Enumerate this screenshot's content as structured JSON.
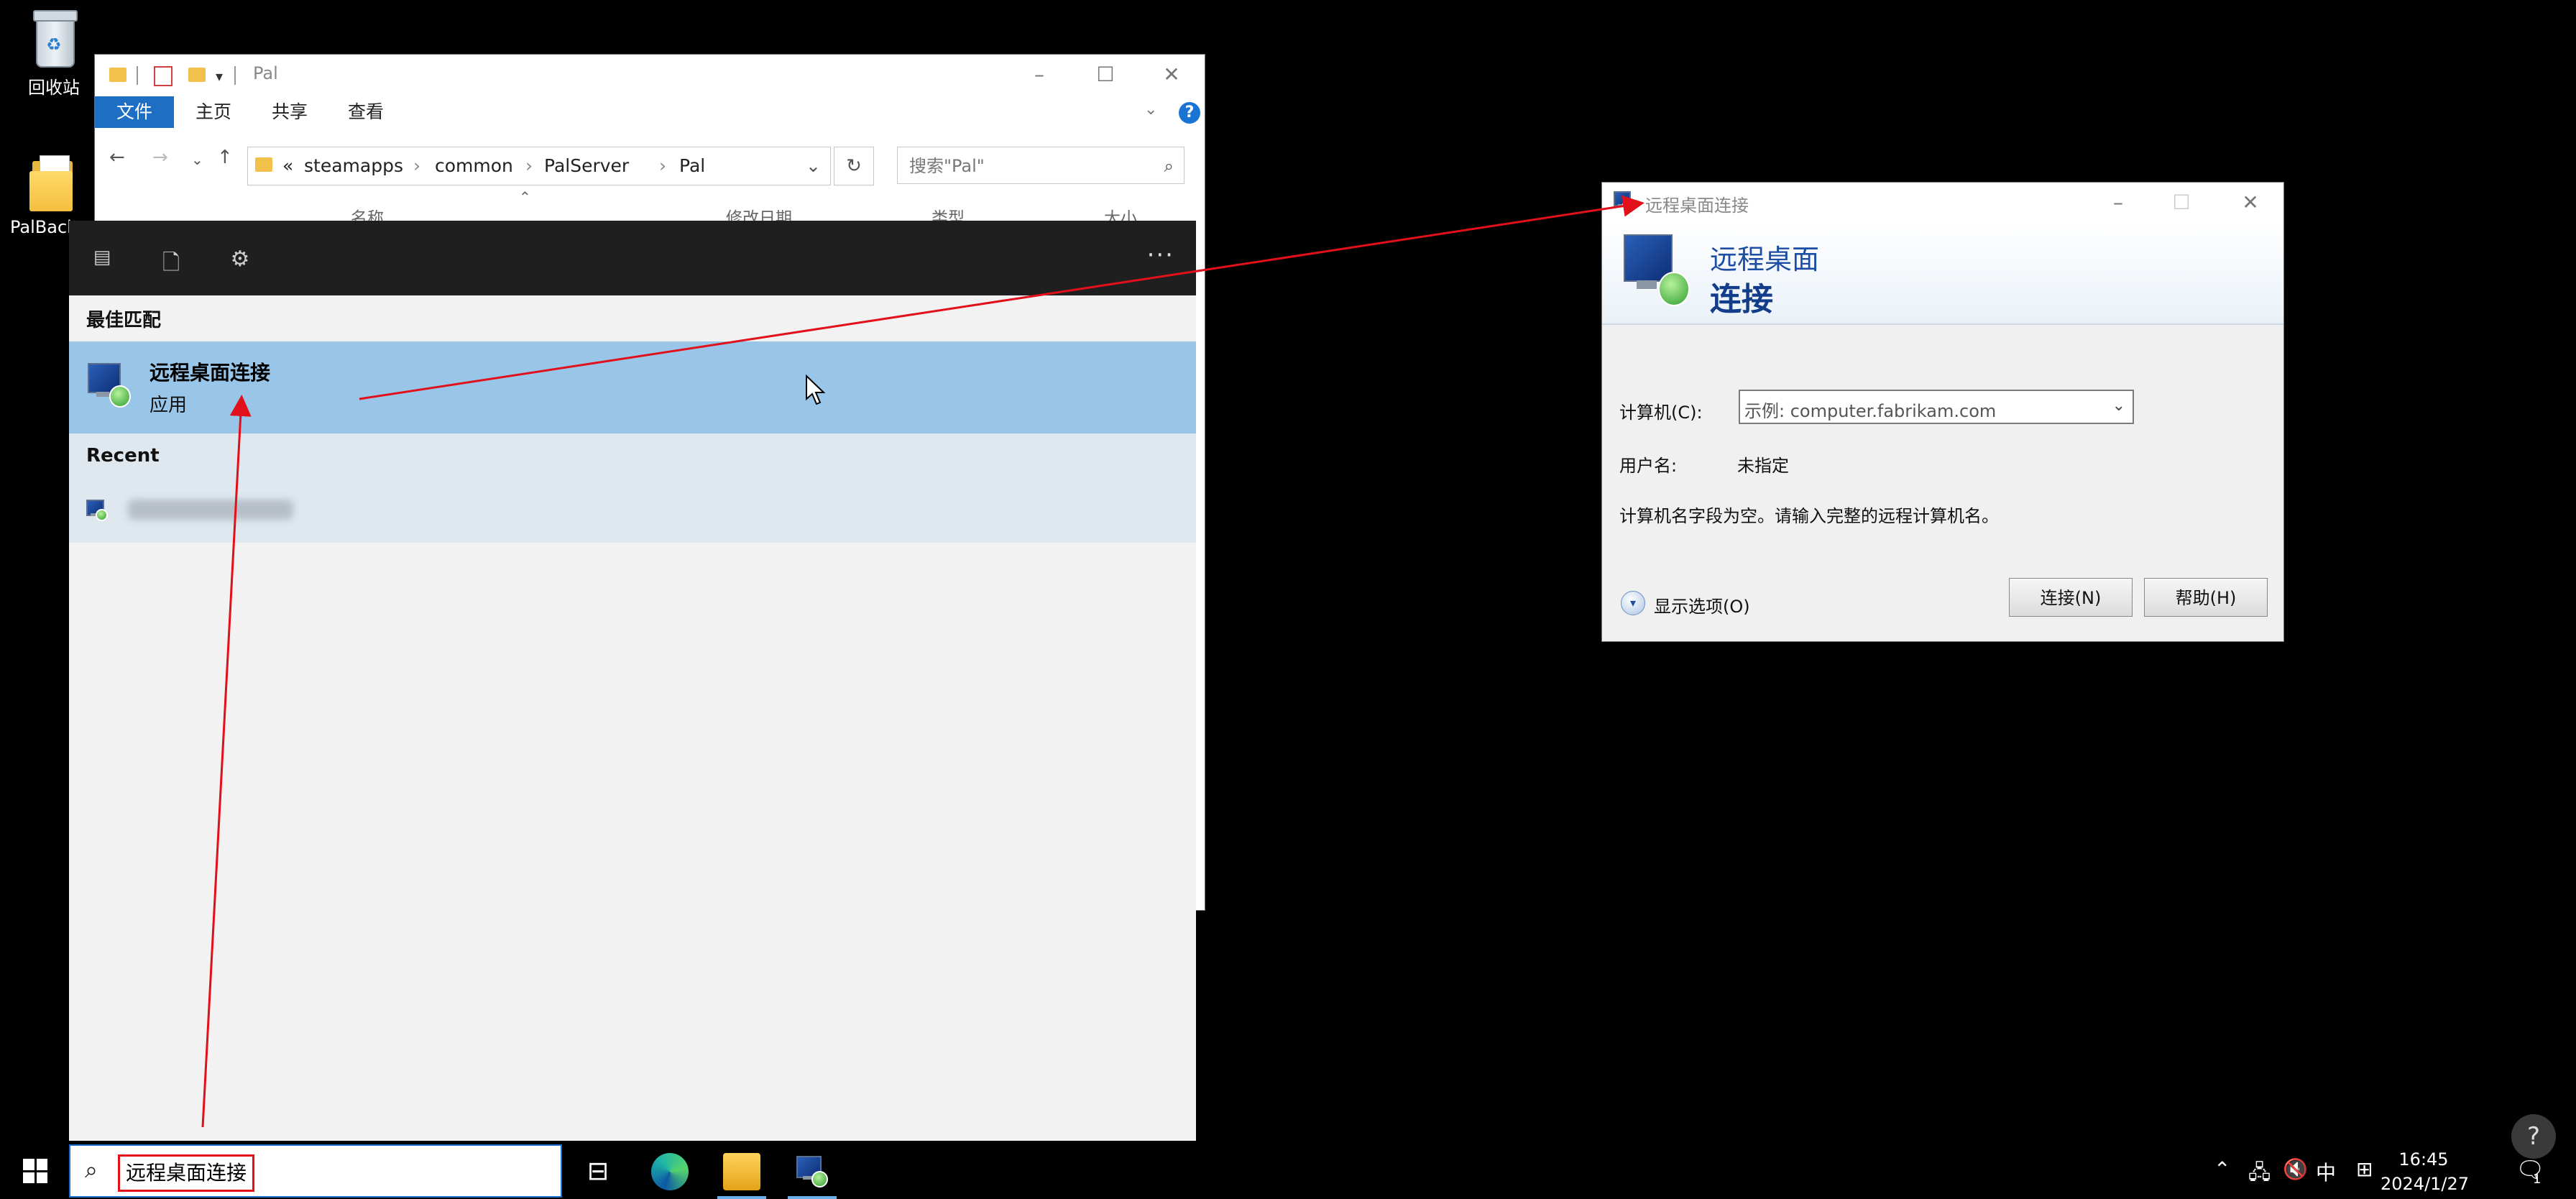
{
  "desktop": {
    "icons": [
      {
        "label": "回收站"
      },
      {
        "label": "PalBacl"
      }
    ]
  },
  "explorer": {
    "title": "Pal",
    "ribbon_tabs": [
      "文件",
      "主页",
      "共享",
      "查看"
    ],
    "breadcrumbs": [
      "«",
      "steamapps",
      "common",
      "PalServer",
      "Pal"
    ],
    "search_placeholder": "搜索\"Pal\"",
    "columns": [
      "名称",
      "修改日期",
      "类型",
      "大小"
    ]
  },
  "start_panel": {
    "best_match_heading": "最佳匹配",
    "best_match": {
      "name": "远程桌面连接",
      "kind": "应用"
    },
    "recent_heading": "Recent"
  },
  "taskbar": {
    "search_query": "远程桌面连接",
    "ime_label": "中",
    "time": "16:45",
    "date": "2024/1/27",
    "notification_count": "1"
  },
  "rdp_dialog": {
    "title": "远程桌面连接",
    "banner_line1": "远程桌面",
    "banner_line2": "连接",
    "computer_label": "计算机(C):",
    "computer_placeholder": "示例: computer.fabrikam.com",
    "username_label": "用户名:",
    "username_value": "未指定",
    "message": "计算机名字段为空。请输入完整的远程计算机名。",
    "show_options": "显示选项(O)",
    "connect_button": "连接(N)",
    "help_button": "帮助(H)"
  },
  "colors": {
    "accent_blue": "#1e6fc4",
    "selection_blue": "#99c5e8",
    "annotation_red": "#e1101a"
  }
}
